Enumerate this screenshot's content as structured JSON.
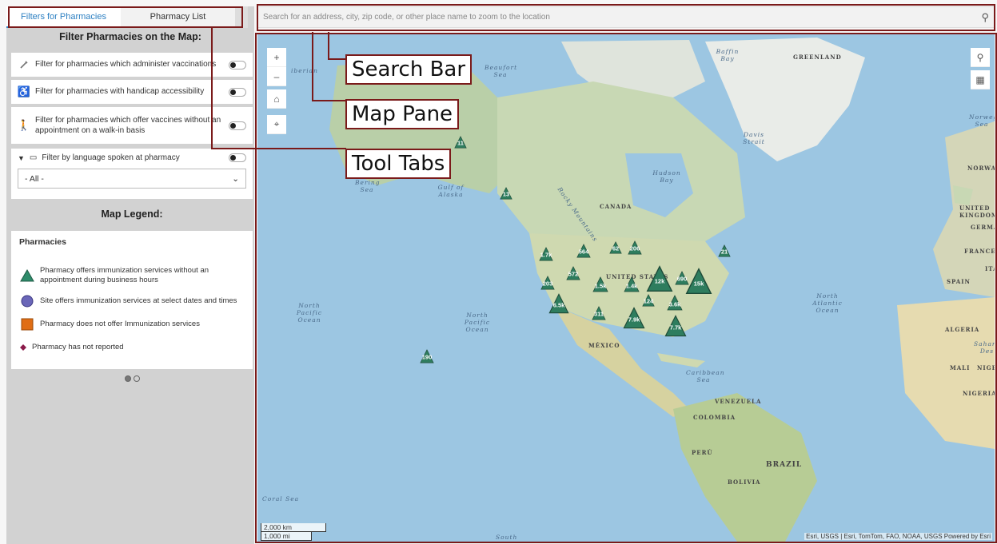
{
  "tabs": [
    {
      "label": "Filters for Pharmacies",
      "active": true
    },
    {
      "label": "Pharmacy List",
      "active": false
    }
  ],
  "filter_panel": {
    "title": "Filter Pharmacies on the Map:",
    "filters": [
      {
        "label": "Filter for pharmacies which administer vaccinations",
        "icon": "syringe-icon"
      },
      {
        "label": "Filter for pharmacies with handicap accessibility",
        "icon": "wheelchair-icon"
      },
      {
        "label": "Filter for pharmacies which offer vaccines without an appointment on a walk-in basis",
        "icon": "walking-person-icon"
      }
    ],
    "language": {
      "label": "Filter by language spoken at pharmacy",
      "selected": "- All -"
    }
  },
  "legend": {
    "title": "Map Legend:",
    "heading": "Pharmacies",
    "items": [
      {
        "label": "Pharmacy offers immunization services without an appointment during business hours",
        "color": "#2e8b6a"
      },
      {
        "label": "Site offers immunization services at select dates and times",
        "color": "#6a66b8"
      },
      {
        "label": "Pharmacy does not offer Immunization services",
        "color": "#e06d14"
      },
      {
        "label": "Pharmacy has not reported",
        "color": "#8b1a4a"
      }
    ]
  },
  "search": {
    "placeholder": "Search for an address, city, zip code, or other place name to zoom to the location"
  },
  "map": {
    "labels": {
      "greenland": "GREENLAND",
      "canada": "CANADA",
      "united_states": "UNITED STATES",
      "mexico": "MÉXICO",
      "brazil": "BRAZIL",
      "peru": "PERÚ",
      "bolivia": "BOLIVIA",
      "venezuela": "VENEZUELA",
      "colombia": "COLOMBIA",
      "norway": "NORWAY",
      "uk": "UNITED KINGDOM",
      "france": "FRANCE",
      "spain": "SPAIN",
      "algeria": "ALGERIA",
      "mali": "MALI",
      "niger": "NIGER",
      "nigeria": "NIGERIA",
      "north_pacific_w": "North Pacific Ocean",
      "north_pacific_c": "North Pacific Ocean",
      "north_atlantic": "North Atlantic Ocean",
      "hudson_bay": "Hudson Bay",
      "baffin_bay": "Baffin Bay",
      "beaufort_sea": "Beaufort Sea",
      "bering_sea": "Bering Sea",
      "gulf_alaska": "Gulf of Alaska",
      "caribbean": "Caribbean Sea",
      "davis_strait": "Davis Strait",
      "norwegian_sea": "Norwegian Sea",
      "coral_sea": "Coral Sea",
      "south": "South",
      "sahara": "Sahara Des",
      "germany": "GERMANY",
      "italy": "ITAL",
      "rocky": "Rocky Mountains",
      "siberian": "iberian"
    },
    "clusters": [
      "11",
      "13",
      "1.7k",
      "564",
      "62",
      "206",
      "21",
      "572",
      "12k",
      "690",
      "15k",
      "203",
      "1.5k",
      "1.4k",
      "6.5k",
      "124",
      "3.6k",
      "311",
      "7.9k",
      "7.7k",
      "190"
    ],
    "scale": {
      "km": "2,000 km",
      "mi": "1,000 mi"
    },
    "attribution": "Esri, USGS | Esri, TomTom, FAO, NOAA, USGS   Powered by Esri"
  },
  "annotations": {
    "search_bar": "Search Bar",
    "map_pane": "Map Pane",
    "tool_tabs": "Tool Tabs"
  },
  "colors": {
    "accent": "#2b7fc2",
    "cluster": "#2e7d5e",
    "annotation": "#7a1a1a"
  }
}
